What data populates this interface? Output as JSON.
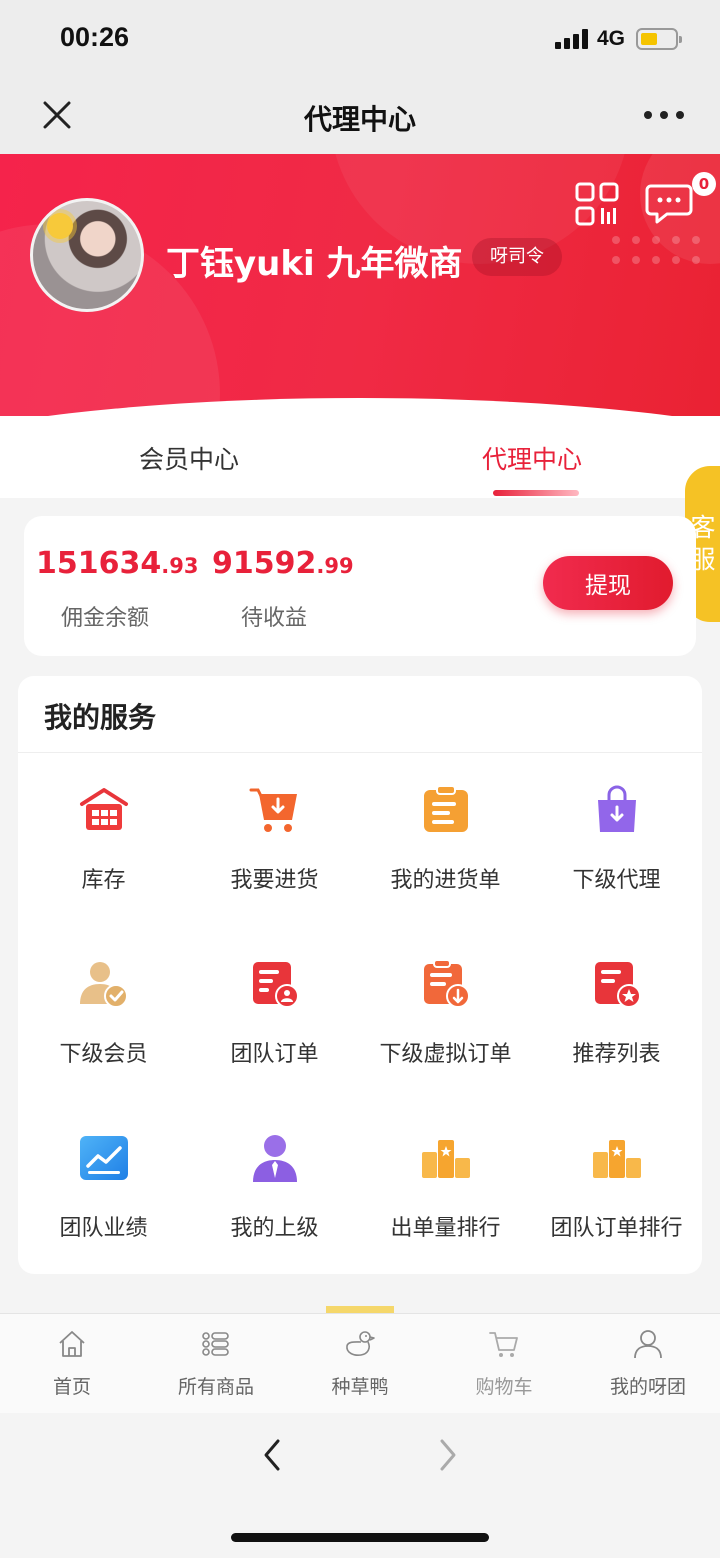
{
  "status_bar": {
    "time": "00:26",
    "network": "4G"
  },
  "nav": {
    "title": "代理中心"
  },
  "profile": {
    "name": "丁钰yuki 九年微商",
    "tag": "呀司令",
    "message_count": "0"
  },
  "tabs": [
    {
      "label": "会员中心",
      "active": false
    },
    {
      "label": "代理中心",
      "active": true
    }
  ],
  "balance": {
    "commission_int": "151634",
    "commission_dec": ".93",
    "commission_label": "佣金余额",
    "pending_int": "91592",
    "pending_dec": ".99",
    "pending_label": "待收益",
    "withdraw_label": "提现"
  },
  "customer_service": {
    "line1": "客",
    "line2": "服"
  },
  "services": {
    "title": "我的服务",
    "items": [
      {
        "label": "库存",
        "icon": "warehouse-icon"
      },
      {
        "label": "我要进货",
        "icon": "cart-download-icon"
      },
      {
        "label": "我的进货单",
        "icon": "clipboard-icon"
      },
      {
        "label": "下级代理",
        "icon": "bag-download-icon"
      },
      {
        "label": "下级会员",
        "icon": "user-check-icon"
      },
      {
        "label": "团队订单",
        "icon": "order-team-icon"
      },
      {
        "label": "下级虚拟订单",
        "icon": "order-download-icon"
      },
      {
        "label": "推荐列表",
        "icon": "order-star-icon"
      },
      {
        "label": "团队业绩",
        "icon": "trend-chart-icon"
      },
      {
        "label": "我的上级",
        "icon": "manager-icon"
      },
      {
        "label": "出单量排行",
        "icon": "ranking-podium-icon"
      },
      {
        "label": "团队订单排行",
        "icon": "ranking-podium-icon"
      }
    ]
  },
  "bottom_nav": [
    {
      "label": "首页",
      "icon": "home-icon"
    },
    {
      "label": "所有商品",
      "icon": "list-icon"
    },
    {
      "label": "种草鸭",
      "icon": "duck-icon"
    },
    {
      "label": "购物车",
      "icon": "cart-icon"
    },
    {
      "label": "我的呀团",
      "icon": "user-icon"
    }
  ],
  "colors": {
    "brand_red": "#e8213a",
    "accent_yellow": "#f5c225"
  }
}
